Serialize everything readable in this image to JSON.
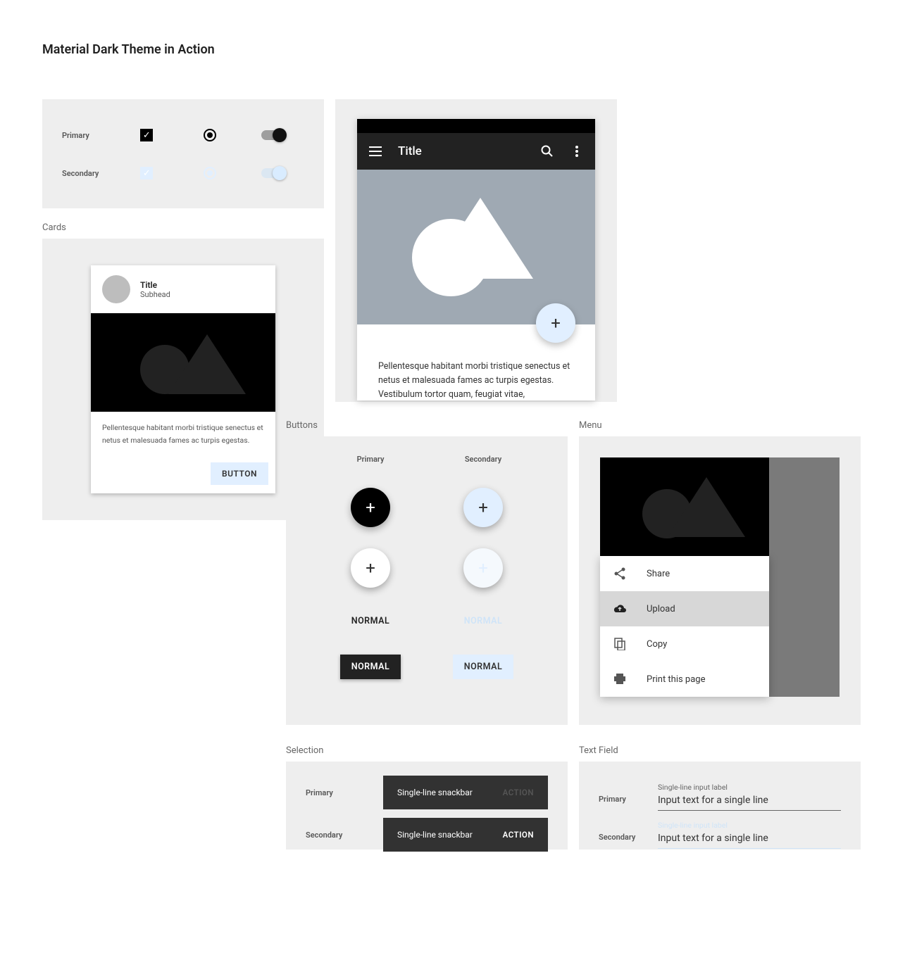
{
  "page_title": "Material Dark Theme in Action",
  "labels": {
    "primary": "Primary",
    "secondary": "Secondary",
    "cards": "Cards",
    "buttons": "Buttons",
    "menu": "Menu",
    "selection": "Selection",
    "text_field": "Text Field"
  },
  "card": {
    "title": "Title",
    "subhead": "Subhead",
    "body": "Pellentesque habitant morbi tristique senectus et netus et malesuada fames ac turpis egestas.",
    "button": "BUTTON"
  },
  "appbar": {
    "title": "Title",
    "body": "Pellentesque habitant morbi tristique senectus et netus et malesuada fames ac turpis egestas. Vestibulum tortor quam, feugiat vitae,"
  },
  "buttons": {
    "normal": "NORMAL"
  },
  "menu": {
    "items": [
      {
        "icon": "share",
        "label": "Share"
      },
      {
        "icon": "upload",
        "label": "Upload"
      },
      {
        "icon": "copy",
        "label": "Copy"
      },
      {
        "icon": "print",
        "label": "Print this page"
      }
    ]
  },
  "snackbar": {
    "text": "Single-line snackbar",
    "action": "ACTION"
  },
  "textfield": {
    "label": "Single-line input label",
    "value": "Input text for a single line"
  }
}
